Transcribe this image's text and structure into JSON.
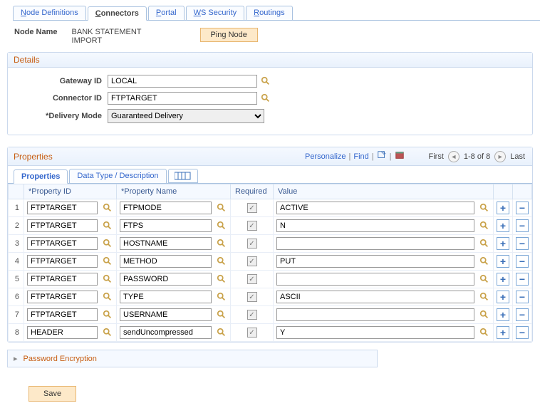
{
  "tabs": {
    "node_definitions": "Node Definitions",
    "connectors": "Connectors",
    "portal": "Portal",
    "ws_security": "WS Security",
    "routings": "Routings"
  },
  "header": {
    "node_name_label": "Node Name",
    "node_name_value": "BANK STATEMENT IMPORT",
    "ping_node": "Ping Node"
  },
  "details": {
    "title": "Details",
    "gateway_id_label": "Gateway ID",
    "gateway_id_value": "LOCAL",
    "connector_id_label": "Connector ID",
    "connector_id_value": "FTPTARGET",
    "delivery_mode_label": "*Delivery Mode",
    "delivery_mode_value": "Guaranteed Delivery"
  },
  "properties": {
    "title": "Properties",
    "toolbar": {
      "personalize": "Personalize",
      "find": "Find",
      "first": "First",
      "range": "1-8 of 8",
      "last": "Last"
    },
    "sub_tabs": {
      "properties": "Properties",
      "data_type_desc": "Data Type / Description"
    },
    "columns": {
      "property_id": "*Property ID",
      "property_name": "*Property Name",
      "required": "Required",
      "value": "Value"
    },
    "rows": [
      {
        "num": "1",
        "pid": "FTPTARGET",
        "pname": "FTPMODE",
        "required": true,
        "value": "ACTIVE"
      },
      {
        "num": "2",
        "pid": "FTPTARGET",
        "pname": "FTPS",
        "required": true,
        "value": "N"
      },
      {
        "num": "3",
        "pid": "FTPTARGET",
        "pname": "HOSTNAME",
        "required": true,
        "value": ""
      },
      {
        "num": "4",
        "pid": "FTPTARGET",
        "pname": "METHOD",
        "required": true,
        "value": "PUT"
      },
      {
        "num": "5",
        "pid": "FTPTARGET",
        "pname": "PASSWORD",
        "required": true,
        "value": ""
      },
      {
        "num": "6",
        "pid": "FTPTARGET",
        "pname": "TYPE",
        "required": true,
        "value": "ASCII"
      },
      {
        "num": "7",
        "pid": "FTPTARGET",
        "pname": "USERNAME",
        "required": true,
        "value": ""
      },
      {
        "num": "8",
        "pid": "HEADER",
        "pname": "sendUncompressed",
        "required": true,
        "value": "Y"
      }
    ]
  },
  "password_encryption": {
    "title": "Password Encryption"
  },
  "buttons": {
    "save": "Save"
  }
}
